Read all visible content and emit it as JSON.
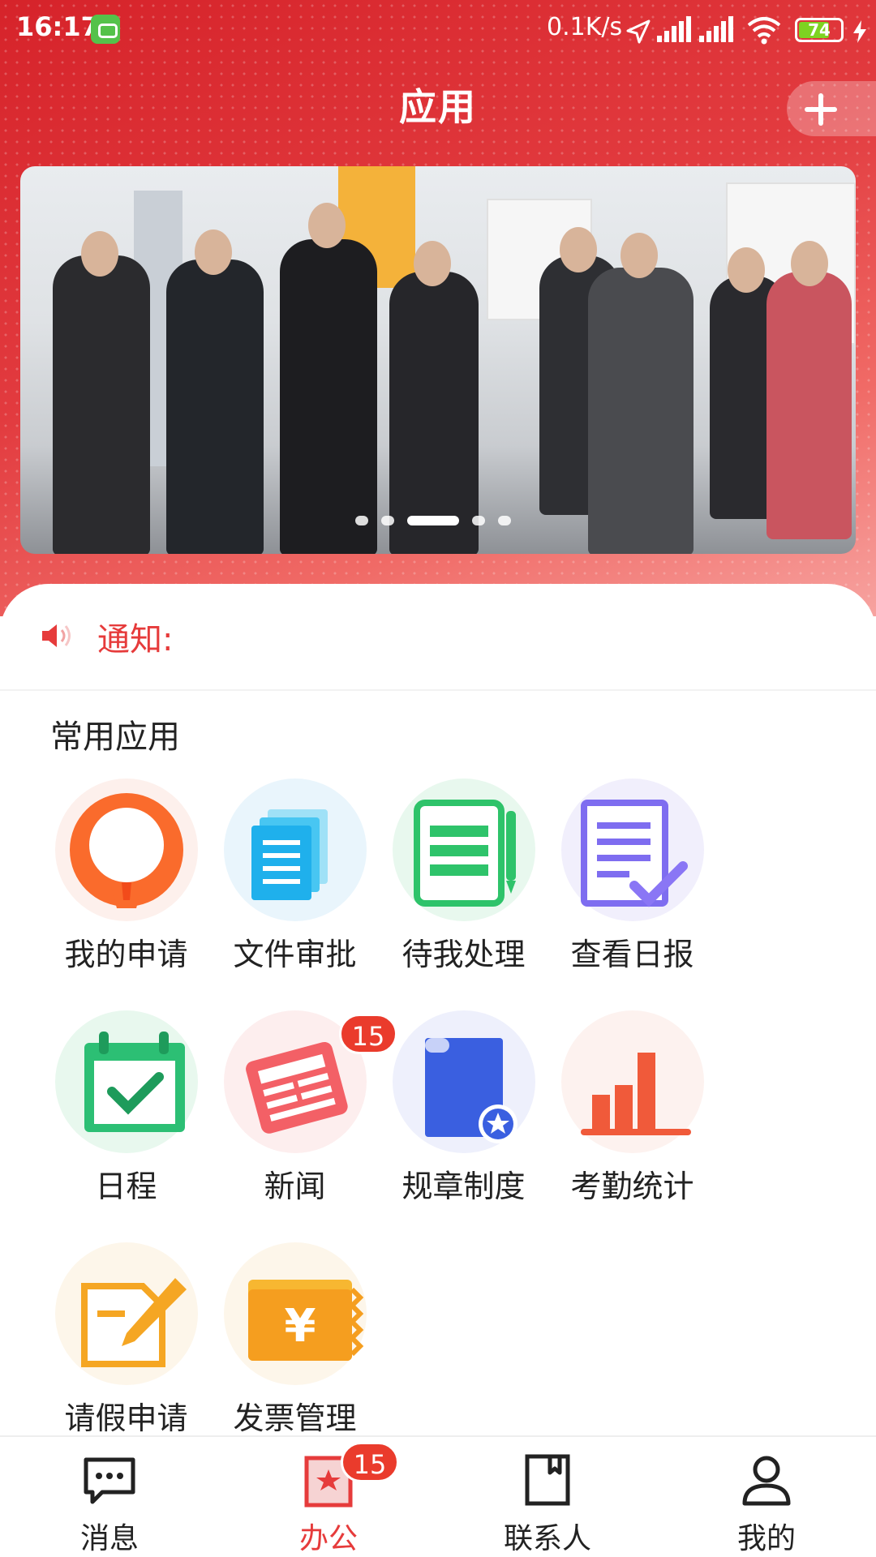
{
  "status_bar": {
    "time": "16:17",
    "network_speed": "0.1K/s",
    "battery_level": "74",
    "battery_percent": 74
  },
  "header": {
    "title": "应用",
    "add_icon": "plus-icon"
  },
  "banner": {
    "total_slides": 5,
    "active_slide": 3
  },
  "notice": {
    "label": "通知:",
    "icon": "speaker-icon",
    "color": "#e63b3b"
  },
  "common_apps": {
    "title": "常用应用",
    "items": [
      {
        "label": "我的申请",
        "icon": "user-application-icon"
      },
      {
        "label": "文件审批",
        "icon": "document-approval-icon"
      },
      {
        "label": "待我处理",
        "icon": "pending-task-icon"
      },
      {
        "label": "查看日报",
        "icon": "daily-report-icon"
      },
      {
        "label": "日程",
        "icon": "calendar-icon"
      },
      {
        "label": "新闻",
        "icon": "newspaper-icon",
        "badge": "15"
      },
      {
        "label": "规章制度",
        "icon": "regulation-icon"
      },
      {
        "label": "考勤统计",
        "icon": "attendance-chart-icon"
      },
      {
        "label": "请假申请",
        "icon": "leave-request-icon"
      },
      {
        "label": "发票管理",
        "icon": "invoice-icon"
      }
    ]
  },
  "tabbar": {
    "items": [
      {
        "label": "消息",
        "icon": "message-icon"
      },
      {
        "label": "办公",
        "icon": "office-icon",
        "badge": "15",
        "active": true
      },
      {
        "label": "联系人",
        "icon": "contacts-icon"
      },
      {
        "label": "我的",
        "icon": "profile-icon"
      }
    ]
  },
  "colors": {
    "brand": "#d6232a",
    "accent": "#e63b3b",
    "badge": "#ea3b2c"
  }
}
